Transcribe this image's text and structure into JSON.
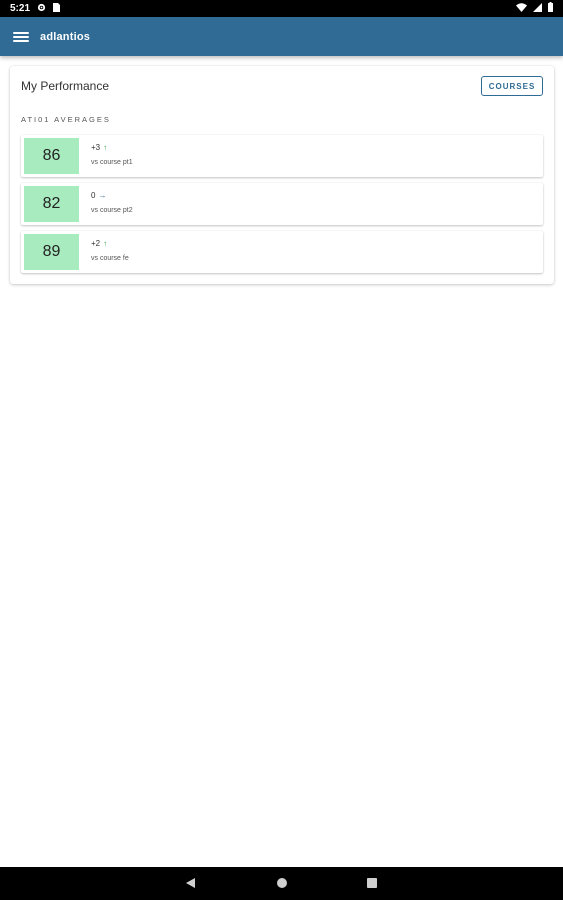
{
  "status_bar": {
    "time": "5:21",
    "icons": [
      "settings-icon",
      "sim-icon",
      "wifi-icon",
      "signal-icon",
      "battery-icon"
    ]
  },
  "app_bar": {
    "title": "adlantios",
    "color": "#2f6b94"
  },
  "card": {
    "title": "My Performance",
    "courses_button": "COURSES",
    "section_label": "ATI01 AVERAGES"
  },
  "scores": [
    {
      "score": "86",
      "delta": "+3",
      "trend": "up",
      "comparison": "vs course pt1"
    },
    {
      "score": "82",
      "delta": "0",
      "trend": "flat",
      "comparison": "vs course pt2"
    },
    {
      "score": "89",
      "delta": "+2",
      "trend": "up",
      "comparison": "vs course fe"
    }
  ],
  "colors": {
    "score_bg": "#a8ebbf",
    "trend_up": "#36a852",
    "trend_flat": "#2f6b94"
  },
  "nav_bar": {
    "buttons": [
      "back-icon",
      "home-icon",
      "recents-icon"
    ]
  }
}
